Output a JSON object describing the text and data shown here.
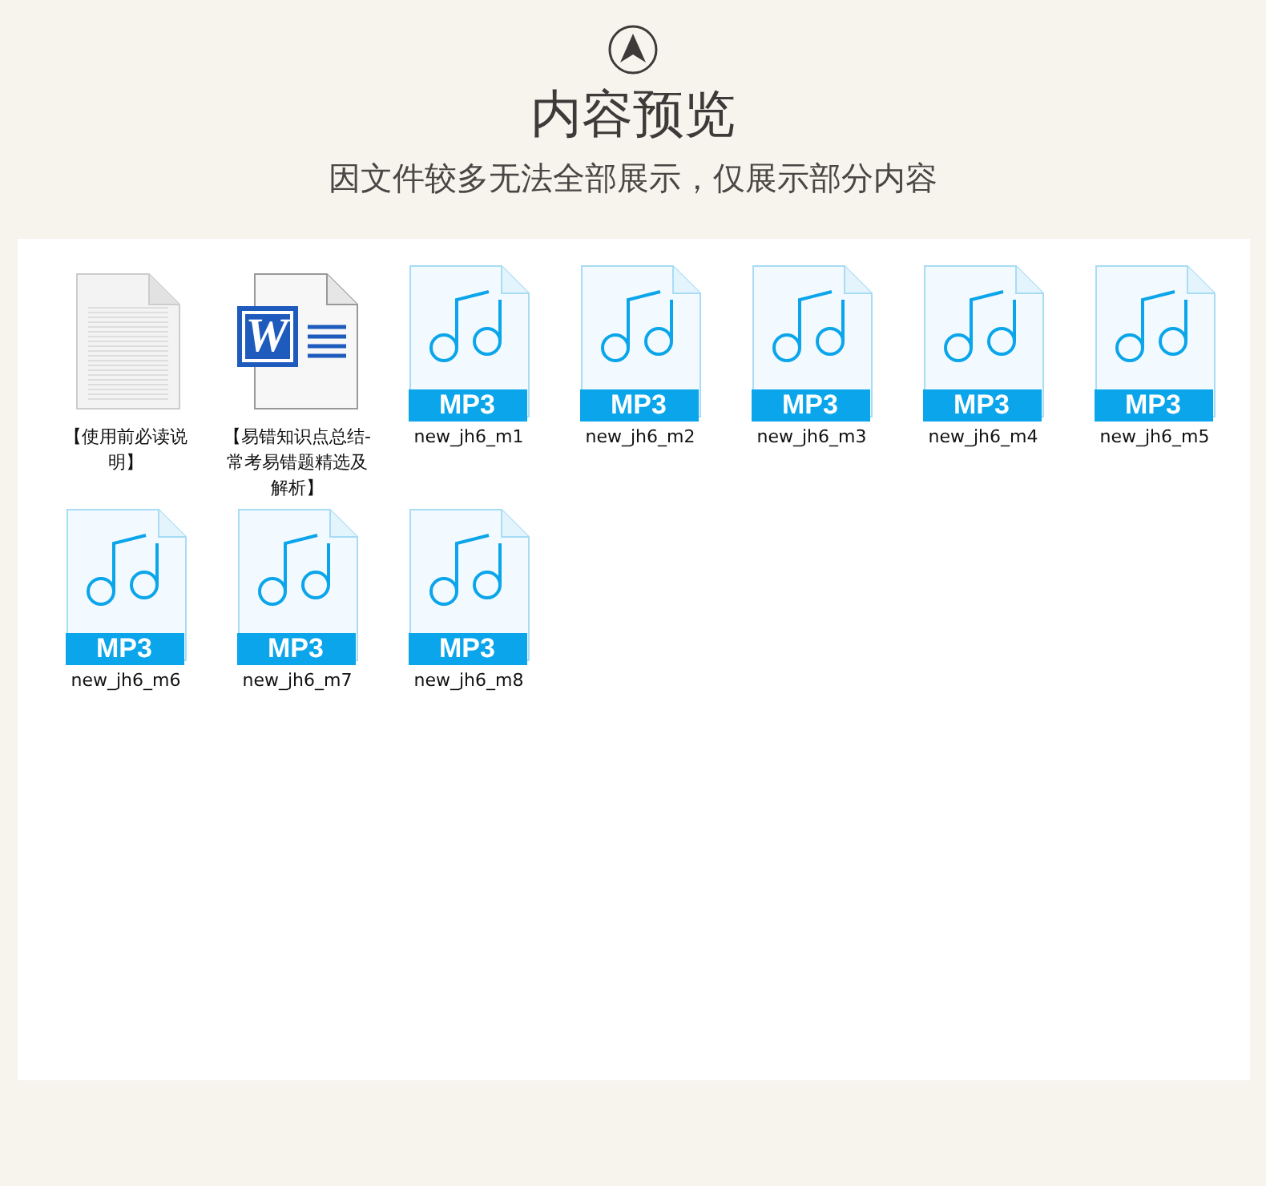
{
  "header": {
    "title": "内容预览",
    "subtitle": "因文件较多无法全部展示，仅展示部分内容"
  },
  "files": [
    {
      "kind": "text",
      "name": "【使用前必读说明】"
    },
    {
      "kind": "word",
      "name": "【易错知识点总结-常考易错题精选及解析】",
      "badge": "W"
    },
    {
      "kind": "audio",
      "name": "new_jh6_m1",
      "badge": "MP3"
    },
    {
      "kind": "audio",
      "name": "new_jh6_m2",
      "badge": "MP3"
    },
    {
      "kind": "audio",
      "name": "new_jh6_m3",
      "badge": "MP3"
    },
    {
      "kind": "audio",
      "name": "new_jh6_m4",
      "badge": "MP3"
    },
    {
      "kind": "audio",
      "name": "new_jh6_m5",
      "badge": "MP3"
    },
    {
      "kind": "audio",
      "name": "new_jh6_m6",
      "badge": "MP3"
    },
    {
      "kind": "audio",
      "name": "new_jh6_m7",
      "badge": "MP3"
    },
    {
      "kind": "audio",
      "name": "new_jh6_m8",
      "badge": "MP3"
    }
  ]
}
